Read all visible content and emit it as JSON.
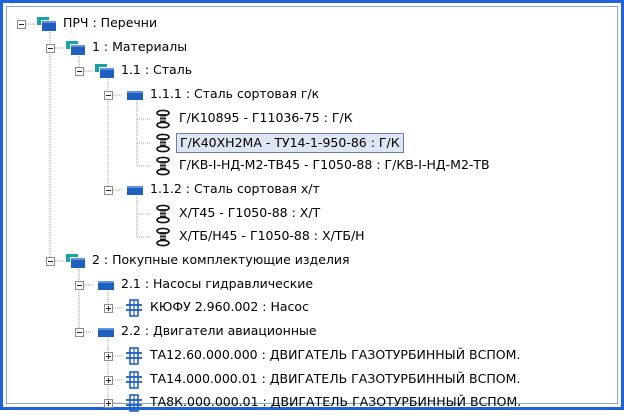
{
  "tree": {
    "nodes": [
      {
        "label": "ПРЧ : Перечни",
        "icon": "folder-group-icon",
        "state": "expanded"
      },
      {
        "label": "1 : Материалы",
        "icon": "folder-group-icon",
        "state": "expanded"
      },
      {
        "label": "1.1 : Сталь",
        "icon": "folder-group-icon",
        "state": "expanded"
      },
      {
        "label": "1.1.1 : Сталь сортовая г/к",
        "icon": "folder-icon",
        "state": "expanded"
      },
      {
        "label": "Г/К10895 - Г11036-75 : Г/К",
        "icon": "material-spool-icon",
        "state": "leaf"
      },
      {
        "label": "Г/К40ХН2МА - ТУ14-1-950-86 : Г/К",
        "icon": "material-spool-icon",
        "state": "leaf",
        "selected": true
      },
      {
        "label": "Г/КВ-I-НД-М2-ТВ45 - Г1050-88 : Г/КВ-I-НД-М2-ТВ",
        "icon": "material-spool-icon",
        "state": "leaf"
      },
      {
        "label": "1.1.2 : Сталь сортовая х/т",
        "icon": "folder-icon",
        "state": "expanded"
      },
      {
        "label": "Х/Т45 - Г1050-88 : Х/Т",
        "icon": "material-spool-icon",
        "state": "leaf"
      },
      {
        "label": "Х/ТБ/Н45 - Г1050-88 : Х/ТБ/Н",
        "icon": "material-spool-icon",
        "state": "leaf"
      },
      {
        "label": "2 : Покупные комплектующие изделия",
        "icon": "folder-group-icon",
        "state": "expanded"
      },
      {
        "label": "2.1 : Насосы гидравлические",
        "icon": "folder-icon",
        "state": "expanded"
      },
      {
        "label": "КЮФУ 2.960.002 : Насос",
        "icon": "assembly-icon",
        "state": "collapsed"
      },
      {
        "label": "2.2 : Двигатели авиационные",
        "icon": "folder-icon",
        "state": "expanded"
      },
      {
        "label": "ТА12.60.000.000 : ДВИГАТЕЛЬ ГАЗОТУРБИННЫЙ ВСПОМ.",
        "icon": "assembly-icon",
        "state": "collapsed"
      },
      {
        "label": "ТА14.000.000.01 : ДВИГАТЕЛЬ ГАЗОТУРБИННЫЙ ВСПОМ.",
        "icon": "assembly-icon",
        "state": "collapsed"
      },
      {
        "label": "ТА8К.000.000.01 : ДВИГАТЕЛЬ ГАЗОТУРБИННЫЙ ВСПОМ.",
        "icon": "assembly-icon",
        "state": "collapsed"
      }
    ]
  },
  "colors": {
    "frame_border": "#1e64d8",
    "folder_blue": "#1f5fbf",
    "folder_teal": "#17a3a6",
    "selection_bg": "#dde6f2"
  }
}
